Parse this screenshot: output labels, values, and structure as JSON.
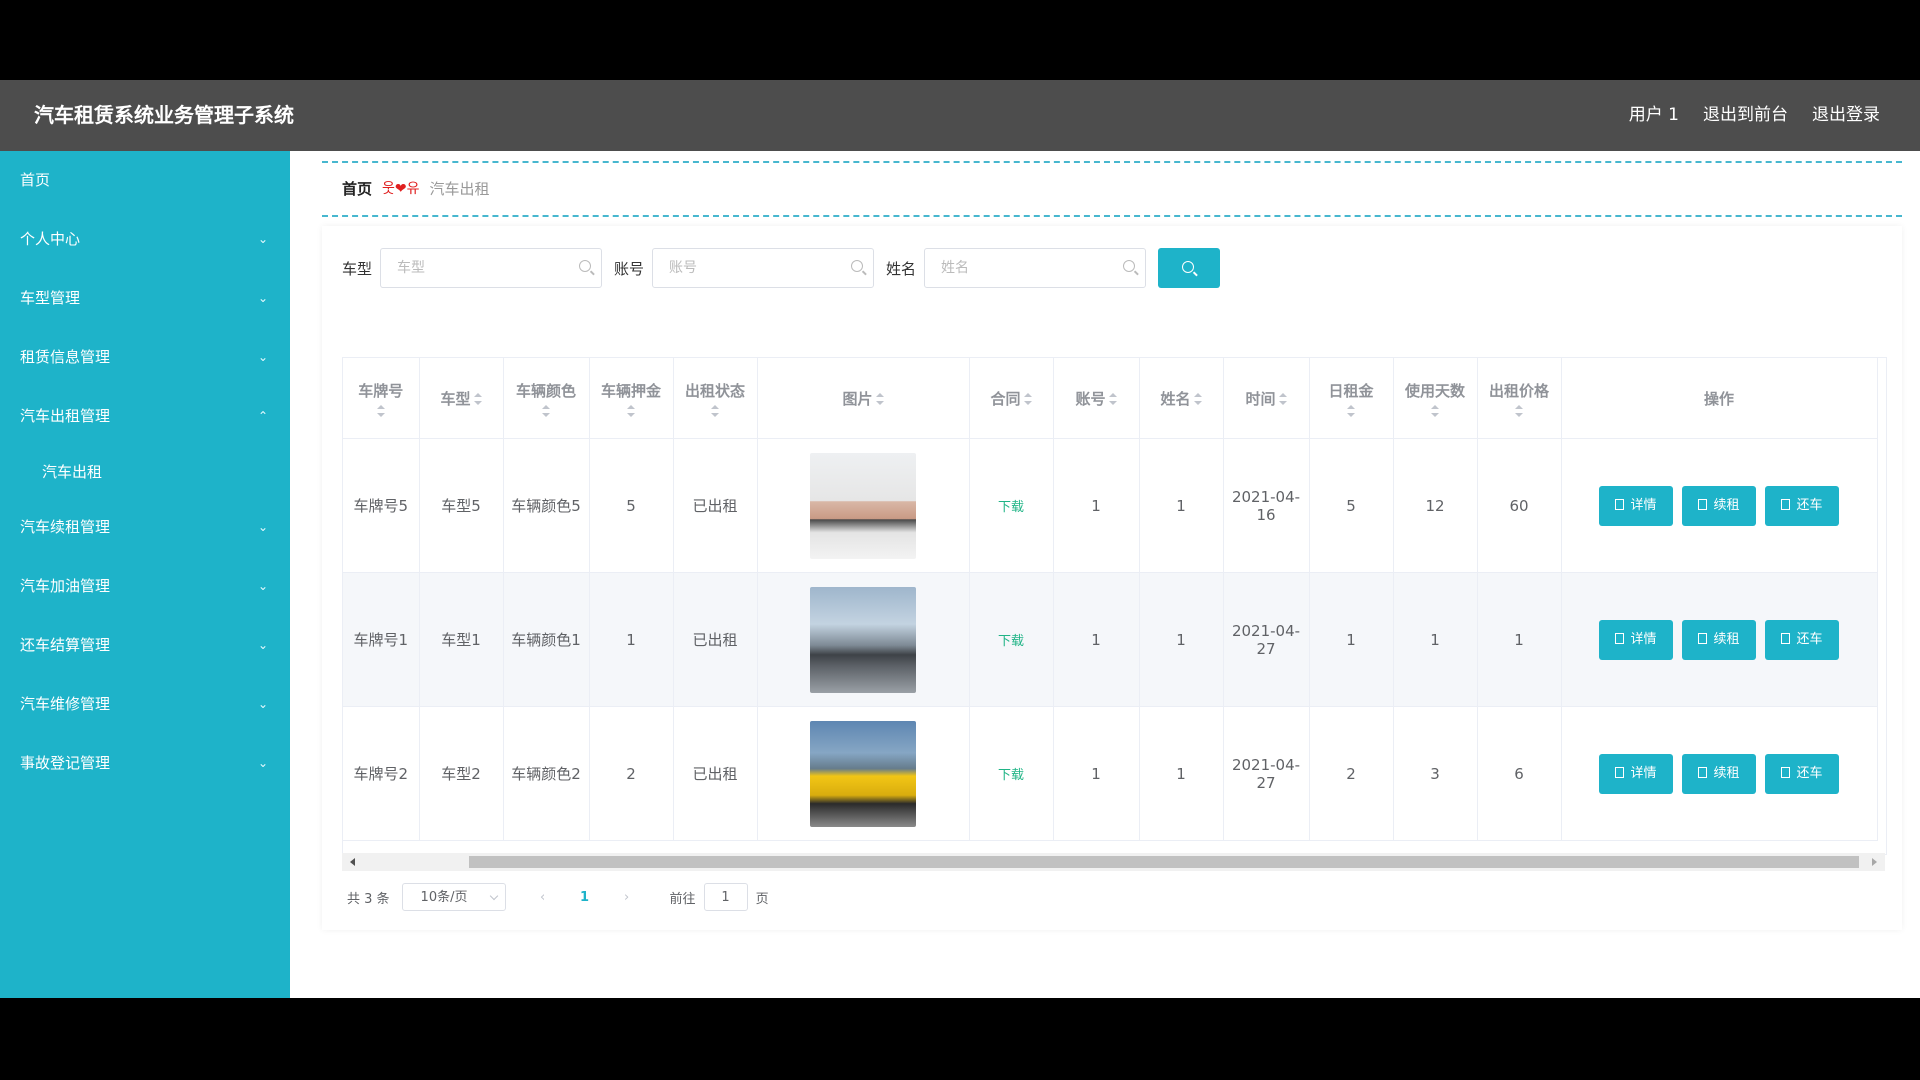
{
  "header": {
    "title": "汽车租赁系统业务管理子系统",
    "user": "用户 1",
    "exit_front": "退出到前台",
    "logout": "退出登录"
  },
  "sidebar": {
    "items": [
      {
        "label": "首页",
        "arrow": ""
      },
      {
        "label": "个人中心",
        "arrow": "chevron-down"
      },
      {
        "label": "车型管理",
        "arrow": "chevron-down"
      },
      {
        "label": "租赁信息管理",
        "arrow": "chevron-down"
      },
      {
        "label": "汽车出租管理",
        "arrow": "chevron-up"
      },
      {
        "label": "汽车续租管理",
        "arrow": "chevron-down"
      },
      {
        "label": "汽车加油管理",
        "arrow": "chevron-down"
      },
      {
        "label": "还车结算管理",
        "arrow": "chevron-down"
      },
      {
        "label": "汽车维修管理",
        "arrow": "chevron-down"
      },
      {
        "label": "事故登记管理",
        "arrow": "chevron-down"
      }
    ],
    "sub_item": "汽车出租"
  },
  "breadcrumb": {
    "home": "首页",
    "separator": "웃❤유",
    "current": "汽车出租"
  },
  "search": {
    "car_type_label": "车型",
    "car_type_placeholder": "车型",
    "account_label": "账号",
    "account_placeholder": "账号",
    "name_label": "姓名",
    "name_placeholder": "姓名"
  },
  "table": {
    "columns": [
      "车牌号",
      "车型",
      "车辆颜色",
      "车辆押金",
      "出租状态",
      "图片",
      "合同",
      "账号",
      "姓名",
      "时间",
      "日租金",
      "使用天数",
      "出租价格",
      "操作"
    ],
    "rows": [
      {
        "plate": "车牌号5",
        "type": "车型5",
        "color": "车辆颜色5",
        "deposit": "5",
        "status": "已出租",
        "image": "pink sports car",
        "contract": "下载",
        "account": "1",
        "name": "1",
        "time": "2021-04-16",
        "daily_rent": "5",
        "days": "12",
        "price": "60"
      },
      {
        "plate": "车牌号1",
        "type": "车型1",
        "color": "车辆颜色1",
        "deposit": "1",
        "status": "已出租",
        "image": "car on bridge",
        "contract": "下载",
        "account": "1",
        "name": "1",
        "time": "2021-04-27",
        "daily_rent": "1",
        "days": "1",
        "price": "1"
      },
      {
        "plate": "车牌号2",
        "type": "车型2",
        "color": "车辆颜色2",
        "deposit": "2",
        "status": "已出租",
        "image": "yellow sports car",
        "contract": "下载",
        "account": "1",
        "name": "1",
        "time": "2021-04-27",
        "daily_rent": "2",
        "days": "3",
        "price": "6"
      }
    ],
    "actions": {
      "detail": "详情",
      "renew": "续租",
      "return": "还车"
    }
  },
  "pagination": {
    "total": "共 3 条",
    "page_size": "10条/页",
    "current_page": "1",
    "goto_label": "前往",
    "goto_value": "1",
    "page_suffix": "页"
  },
  "colors": {
    "accent": "#1eb3c9",
    "header_bg": "#4d4d4d",
    "download": "#20b486"
  }
}
